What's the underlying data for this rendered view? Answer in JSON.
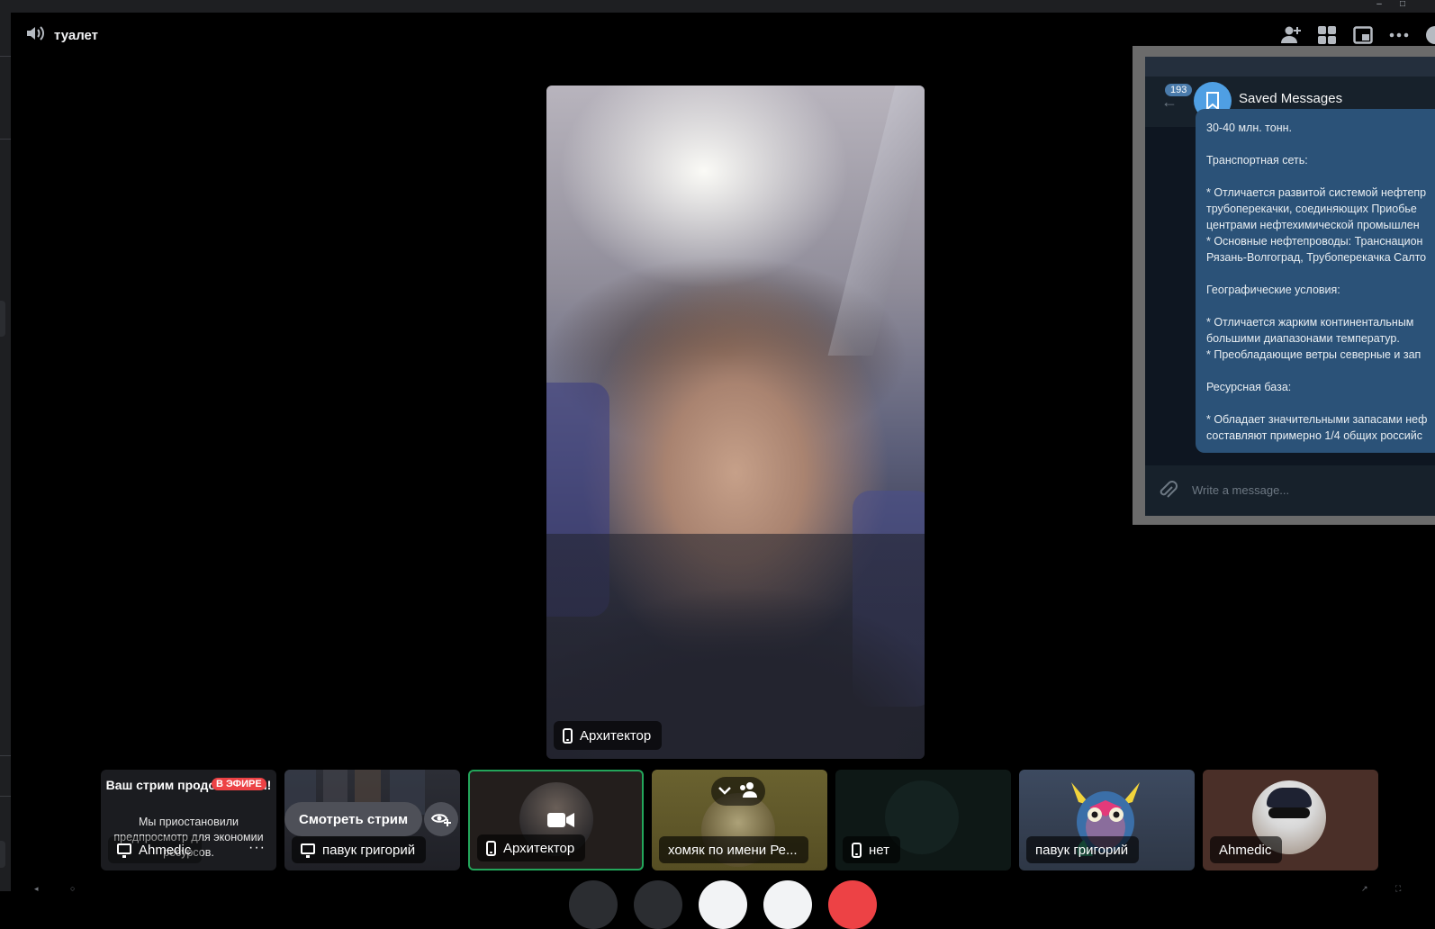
{
  "channel": {
    "name": "туалет",
    "icon": "speaker-icon"
  },
  "window_controls": {
    "minimize": "–",
    "maximize": "□"
  },
  "top_icons": [
    "add-user-icon",
    "grid-icon",
    "popout-icon",
    "more-icon",
    "chat-icon"
  ],
  "main_video": {
    "user": "Архитектор",
    "device_icon": "phone-icon"
  },
  "telegram": {
    "unread_count": "193",
    "chat_title": "Saved Messages",
    "message_text": "30-40 млн. тонн.\n\nТранспортная сеть:\n\n* Отличается развитой системой нефтепр\nтрубоперекачки, соединяющих Приобье\nцентрами нефтехимической промышлен\n* Основные нефтепроводы: Транснацион\nРязань-Волгоград, Трубоперекачка Салто\n\nГеографические условия:\n\n* Отличается жарким континентальным\nбольшими диапазонами температур.\n* Преобладающие ветры северные и зап\n\nРесурсная база:\n\n* Обладает значительными запасами неф\nсоставляют примерно 1/4 общих российс",
    "input_placeholder": "Write a message..."
  },
  "participants": {
    "stream_tile": {
      "title": "Ваш стрим продолжается!",
      "live_badge": "В ЭФИРЕ",
      "subtitle": "Мы приостановили предпросмотр для экономии ресурсов.",
      "user": "Ahmedic",
      "more": "···"
    },
    "preview_tile": {
      "watch_button": "Смотреть стрим",
      "user": "павук григорий"
    },
    "arch_tile": {
      "user": "Архитектор"
    },
    "hamster_tile": {
      "user": "хомяк по имени Ре..."
    },
    "net_tile": {
      "user": "нет"
    },
    "pavuk_tile": {
      "user": "павук григорий"
    },
    "ahmedic_tile": {
      "user": "Ahmedic"
    }
  },
  "colors": {
    "speaking_outline": "#23a55a",
    "live_red": "#ed4245",
    "telegram_bubble": "#2b5278",
    "telegram_accent": "#4f9fe3"
  }
}
